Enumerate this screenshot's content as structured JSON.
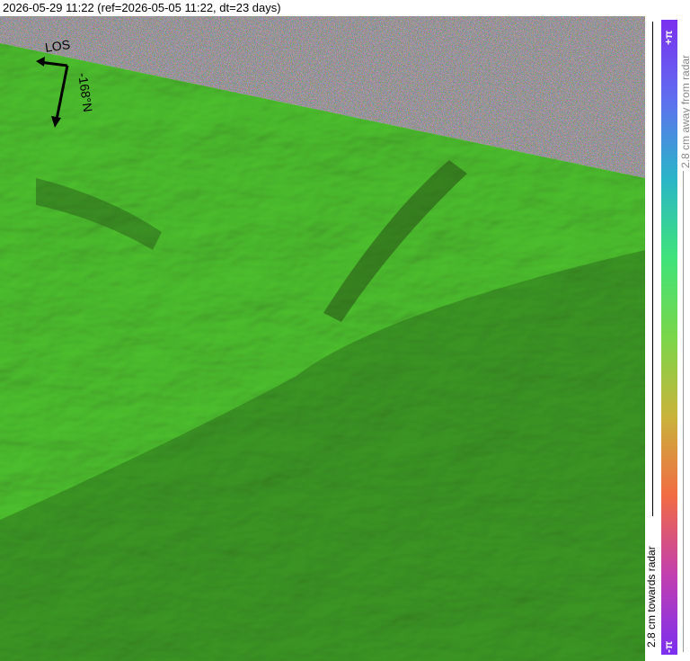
{
  "title": "2026-05-29 11:22 (ref=2026-05-05 11:22, dt=23 days)",
  "colorbar": {
    "top_label": "+π",
    "bottom_label": "-π",
    "away_label": "2.8 cm away from radar",
    "towards_label": "2.8 cm towards radar",
    "colors": [
      "#7b2ff0",
      "#5f6ff0",
      "#2ab5c8",
      "#3fe37a",
      "#7ad64a",
      "#c9b33b",
      "#f26b43",
      "#c23fb0",
      "#7b2ff0"
    ]
  },
  "overlay": {
    "los_label": "LOS",
    "heading_label": "-168°N",
    "arrow_color": "#000000"
  },
  "map": {
    "deformation_color": "#6fd64a",
    "noise_region": "top-right"
  }
}
